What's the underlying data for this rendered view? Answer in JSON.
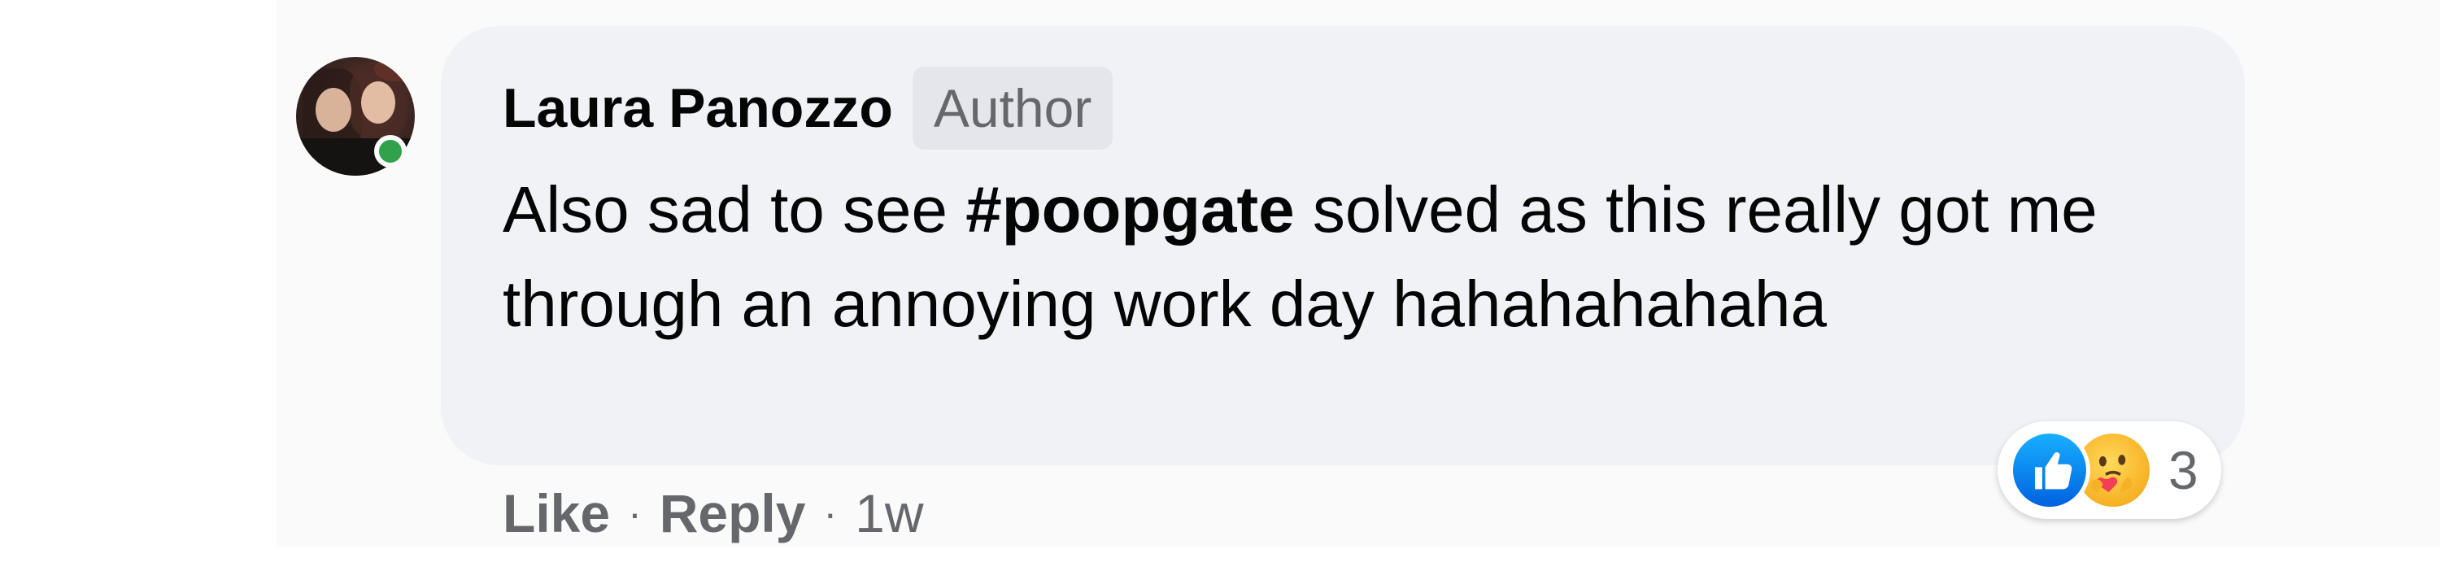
{
  "comment": {
    "author_name": "Laura Panozzo",
    "author_badge": "Author",
    "text_before": "Also sad to see ",
    "hashtag": "#poopgate",
    "text_after": " solved as this really got me through an annoying work day hahahahahaha",
    "online": true
  },
  "reactions": {
    "types": [
      "like-icon",
      "care-icon"
    ],
    "count": "3"
  },
  "actions": {
    "like_label": "Like",
    "reply_label": "Reply",
    "separator": "·",
    "timestamp": "1w"
  },
  "colors": {
    "bubble_bg": "#f0f2f5",
    "badge_bg": "#e4e6eb",
    "secondary_text": "#65676b",
    "online_green": "#31a24c",
    "like_blue": "#0062df"
  }
}
